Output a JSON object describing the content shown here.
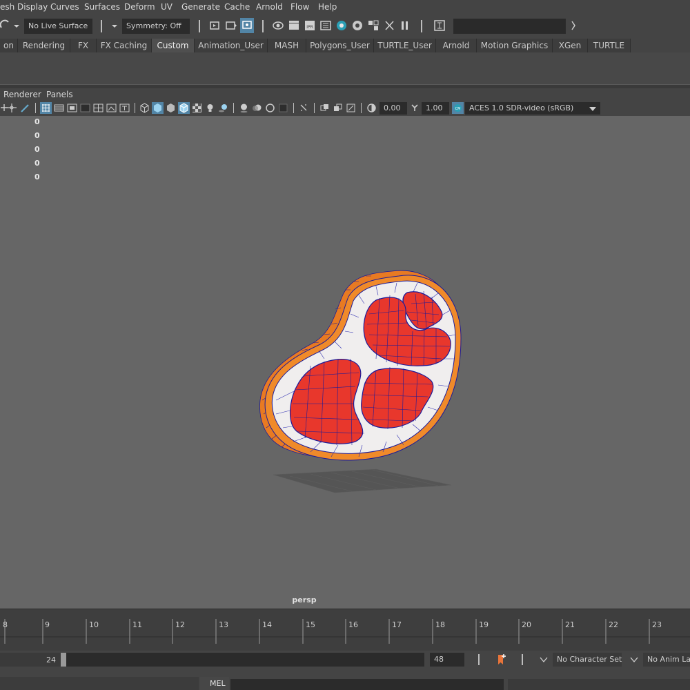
{
  "menubar": {
    "items": [
      "esh Display",
      "Curves",
      "Surfaces",
      "Deform",
      "UV",
      "Generate",
      "Cache",
      "Arnold",
      "Flow",
      "Help"
    ]
  },
  "statusline": {
    "live_surface": "No Live Surface",
    "symmetry": "Symmetry: Off",
    "input_field": ""
  },
  "shelf": {
    "tabs": [
      "on",
      "Rendering",
      "FX",
      "FX Caching",
      "Custom",
      "Animation_User",
      "MASH",
      "Polygons_User",
      "TURTLE_User",
      "Arnold",
      "Motion Graphics",
      "XGen",
      "TURTLE"
    ],
    "active_tab": "Custom"
  },
  "panel_menu": {
    "items": [
      "Renderer",
      "Panels"
    ]
  },
  "panel_toolbar": {
    "exposure": "0.00",
    "gamma": "1.00",
    "color_space": "ACES 1.0 SDR-video (sRGB)"
  },
  "viewport": {
    "hud_values": [
      "0",
      "0",
      "0",
      "0",
      "0"
    ],
    "camera_label": "persp",
    "background_color": "#666666"
  },
  "timeline": {
    "frames": [
      "8",
      "9",
      "10",
      "11",
      "12",
      "13",
      "14",
      "15",
      "16",
      "17",
      "18",
      "19",
      "20",
      "21",
      "22",
      "23"
    ]
  },
  "range": {
    "end_value": "24",
    "max_value": "48",
    "character_set": "No Character Set",
    "anim_layer": "No Anim Lay"
  },
  "command_line": {
    "language": "MEL"
  },
  "colors": {
    "accent_blue": "#5285a6",
    "meat_red": "#e8372c",
    "fat_white": "#f0eeee",
    "rind_orange": "#f08a2a",
    "wire_blue": "#1a1a9a"
  }
}
